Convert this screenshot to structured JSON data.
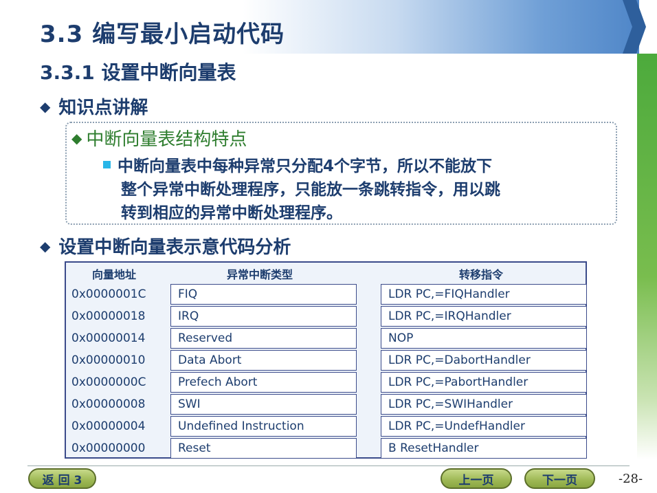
{
  "header": {
    "title": "3.3  编写最小启动代码",
    "subtitle": "3.3.1  设置中断向量表"
  },
  "bullets": {
    "b1": "知识点讲解",
    "b2": "设置中断向量表示意代码分析"
  },
  "box": {
    "heading": "中断向量表结构特点",
    "paragraph_line1": "中断向量表中每种异常只分配4个字节，所以不能放下",
    "paragraph_line2": "整个异常中断处理程序，只能放一条跳转指令，用以跳",
    "paragraph_line3": "转到相应的异常中断处理程序。"
  },
  "table": {
    "headers": [
      "向量地址",
      "异常中断类型",
      "转移指令"
    ],
    "rows": [
      [
        "0x0000001C",
        "FIQ",
        "LDR PC,=FIQHandler"
      ],
      [
        "0x00000018",
        "IRQ",
        "LDR PC,=IRQHandler"
      ],
      [
        "0x00000014",
        "Reserved",
        "NOP"
      ],
      [
        "0x00000010",
        "Data Abort",
        "LDR PC,=DabortHandler"
      ],
      [
        "0x0000000C",
        "Prefech Abort",
        "LDR PC,=PabortHandler"
      ],
      [
        "0x00000008",
        "SWI",
        "LDR PC,=SWIHandler"
      ],
      [
        "0x00000004",
        "Undefined Instruction",
        "LDR PC,=UndefHandler"
      ],
      [
        "0x00000000",
        "Reset",
        "B   ResetHandler"
      ]
    ]
  },
  "footer": {
    "back_label": "返 回 3",
    "prev_label": "上一页",
    "next_label": "下一页",
    "page_number": "-28-"
  },
  "colors": {
    "title": "#1d3d6e",
    "green_heading": "#2e7d2e",
    "bullet_square": "#29b6e8",
    "button_fill": "#9db854"
  }
}
